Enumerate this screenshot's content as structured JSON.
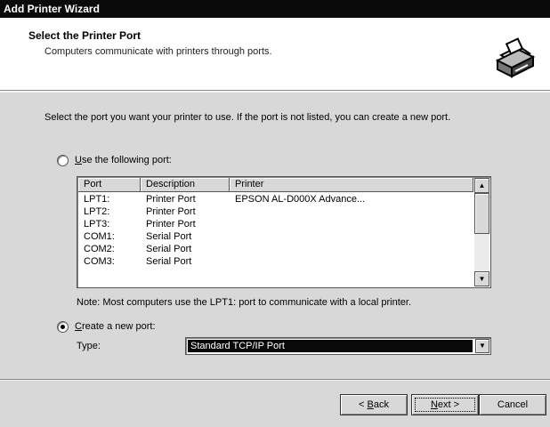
{
  "window": {
    "title": "Add Printer Wizard"
  },
  "header": {
    "title": "Select the Printer Port",
    "subtitle": "Computers communicate with printers through ports.",
    "icon": "printer-icon"
  },
  "intro_text": "Select the port you want your printer to use.  If the port is not listed, you can create a new port.",
  "use_existing": {
    "label_u": "U",
    "label_rest": "se the following port:",
    "selected": false
  },
  "ports_table": {
    "columns": [
      "Port",
      "Description",
      "Printer"
    ],
    "rows": [
      [
        "LPT1:",
        "Printer Port",
        "EPSON AL-D000X Advance..."
      ],
      [
        "LPT2:",
        "Printer Port",
        ""
      ],
      [
        "LPT3:",
        "Printer Port",
        ""
      ],
      [
        "COM1:",
        "Serial Port",
        ""
      ],
      [
        "COM2:",
        "Serial Port",
        ""
      ],
      [
        "COM3:",
        "Serial Port",
        ""
      ]
    ]
  },
  "note": "Note: Most computers use the LPT1: port to communicate with a local printer.",
  "create_new": {
    "label_u": "C",
    "label_rest": "reate a new port:",
    "selected": true
  },
  "port_type": {
    "label": "Type:",
    "value": "Standard TCP/IP Port"
  },
  "buttons": {
    "back": {
      "pre": "< ",
      "u": "B",
      "rest": "ack"
    },
    "next": {
      "u": "N",
      "rest": "ext >"
    },
    "cancel": {
      "label": "Cancel"
    }
  }
}
